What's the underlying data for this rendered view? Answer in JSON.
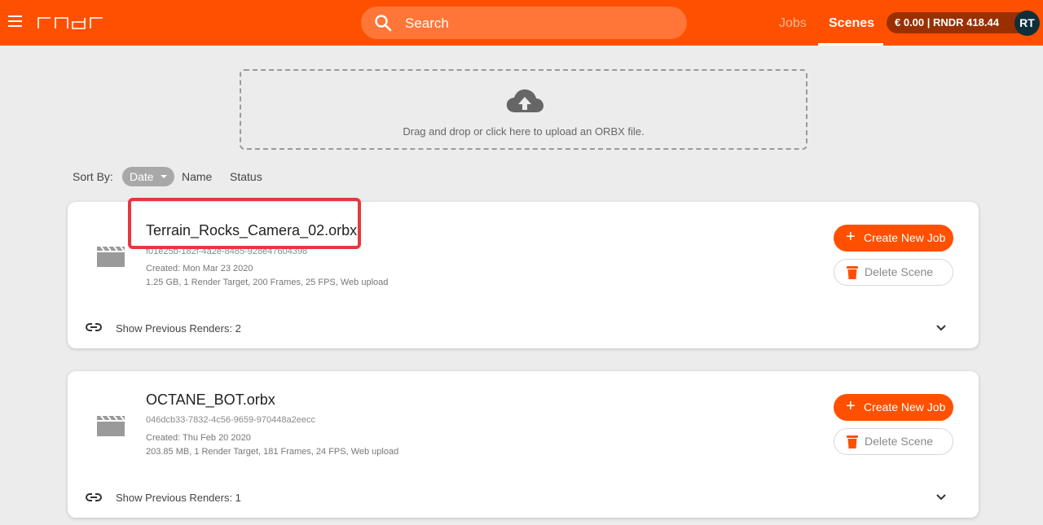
{
  "header": {
    "search_placeholder": "Search",
    "nav": {
      "jobs": "Jobs",
      "scenes": "Scenes"
    },
    "balance": "€ 0.00 | RNDR 418.44",
    "avatar_initials": "RT",
    "accent_color": "#ff5000"
  },
  "upload": {
    "text": "Drag and drop or click here to upload an ORBX file."
  },
  "sort": {
    "label": "Sort By:",
    "options": [
      "Date",
      "Name",
      "Status"
    ],
    "selected": "Date"
  },
  "scenes": [
    {
      "name": "Terrain_Rocks_Camera_02.orbx",
      "id": "f01e25b-182f-4a2e-8485-928e47604398",
      "created": "Created: Mon Mar 23 2020",
      "meta": "1.25 GB, 1 Render Target, 200 Frames, 25 FPS, Web upload",
      "create_label": "Create New Job",
      "delete_label": "Delete Scene",
      "prev_renders": "Show Previous Renders: 2",
      "highlighted": true
    },
    {
      "name": "OCTANE_BOT.orbx",
      "id": "046dcb33-7832-4c56-9659-970448a2eecc",
      "created": "Created: Thu Feb 20 2020",
      "meta": "203.85 MB, 1 Render Target, 181 Frames, 24 FPS, Web upload",
      "create_label": "Create New Job",
      "delete_label": "Delete Scene",
      "prev_renders": "Show Previous Renders: 1",
      "highlighted": false
    }
  ]
}
